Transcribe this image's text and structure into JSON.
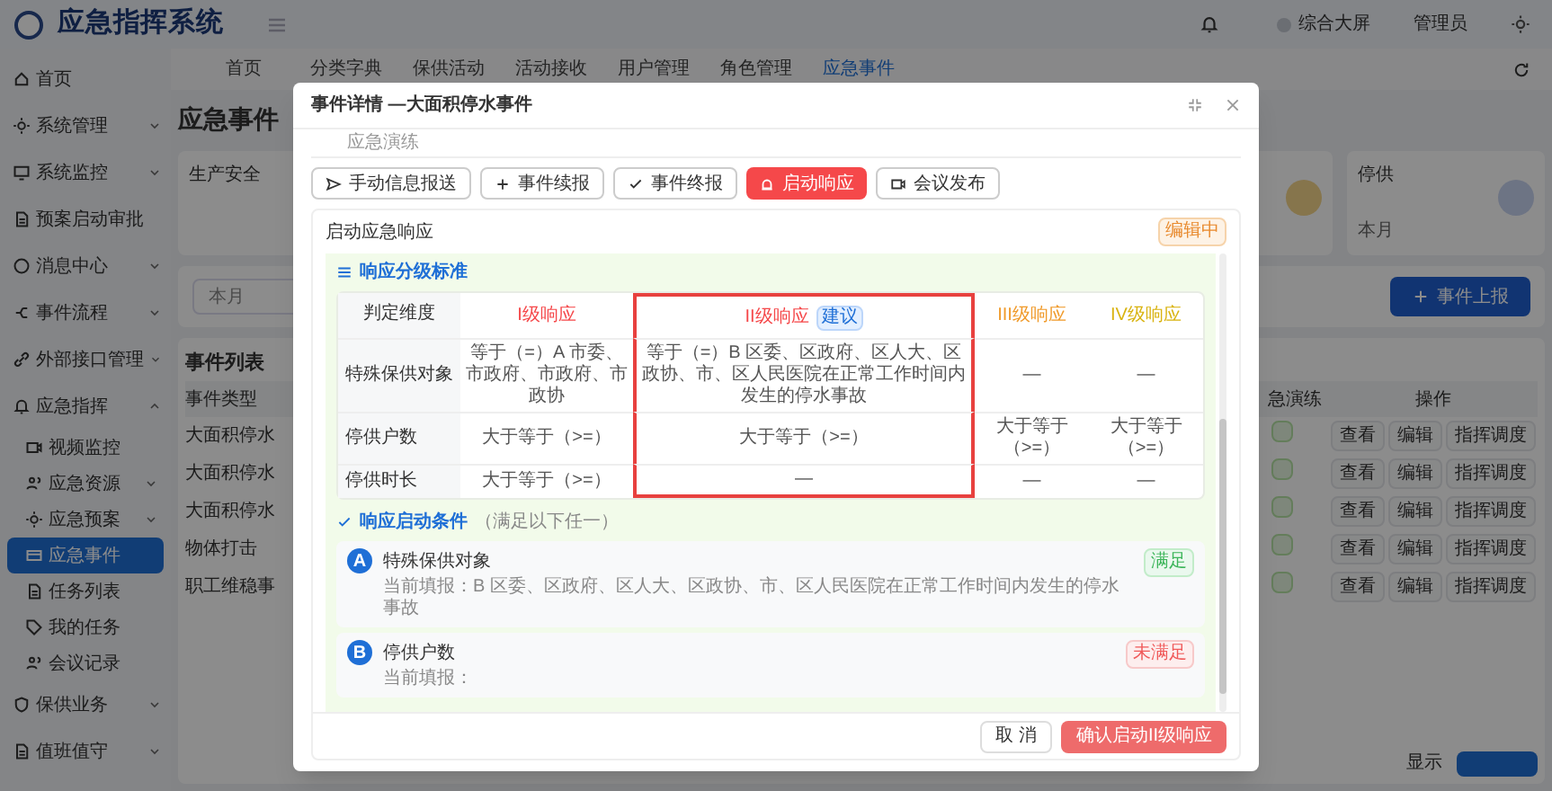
{
  "app": {
    "title": "应急指挥系统",
    "screen_link": "综合大屏",
    "user": "管理员"
  },
  "sidebar": {
    "items": [
      {
        "label": "首页",
        "kind": "link"
      },
      {
        "label": "系统管理",
        "kind": "menu",
        "expanded": false
      },
      {
        "label": "系统监控",
        "kind": "menu",
        "expanded": false
      },
      {
        "label": "预案启动审批",
        "kind": "link"
      },
      {
        "label": "消息中心",
        "kind": "menu",
        "expanded": false
      },
      {
        "label": "事件流程",
        "kind": "menu",
        "expanded": false
      },
      {
        "label": "外部接口管理",
        "kind": "menu",
        "expanded": false
      },
      {
        "label": "应急指挥",
        "kind": "menu",
        "expanded": true,
        "children": [
          {
            "label": "视频监控",
            "kind": "link",
            "selected": false
          },
          {
            "label": "应急资源",
            "kind": "menu",
            "expanded": false,
            "selected": false
          },
          {
            "label": "应急预案",
            "kind": "menu",
            "expanded": false,
            "selected": false
          },
          {
            "label": "应急事件",
            "kind": "link",
            "selected": true
          },
          {
            "label": "任务列表",
            "kind": "link",
            "selected": false
          },
          {
            "label": "我的任务",
            "kind": "link",
            "selected": false
          },
          {
            "label": "会议记录",
            "kind": "link",
            "selected": false
          }
        ]
      },
      {
        "label": "保供业务",
        "kind": "menu",
        "expanded": false
      },
      {
        "label": "值班值守",
        "kind": "menu",
        "expanded": false
      }
    ]
  },
  "tabs": [
    {
      "label": "首页",
      "selected": false
    },
    {
      "label": "分类字典",
      "selected": false
    },
    {
      "label": "保供活动",
      "selected": false
    },
    {
      "label": "活动接收",
      "selected": false
    },
    {
      "label": "用户管理",
      "selected": false
    },
    {
      "label": "角色管理",
      "selected": false
    },
    {
      "label": "应急事件",
      "selected": true
    }
  ],
  "page": {
    "heading": "应急事件",
    "stat_cards": [
      {
        "title": "生产安全"
      },
      {
        "title": "停供",
        "note": "本月"
      }
    ],
    "filter": {
      "value": "本月"
    },
    "report_button": "事件上报",
    "event_list": {
      "title": "事件列表",
      "columns": [
        "事件类型",
        "急演练",
        "操作"
      ],
      "rows": [
        {
          "type": "大面积停水",
          "actions": [
            "查看",
            "编辑",
            "指挥调度"
          ]
        },
        {
          "type": "大面积停水",
          "actions": [
            "查看",
            "编辑",
            "指挥调度"
          ]
        },
        {
          "type": "大面积停水",
          "actions": [
            "查看",
            "编辑",
            "指挥调度"
          ]
        },
        {
          "type": "物体打击",
          "actions": [
            "查看",
            "编辑",
            "指挥调度"
          ]
        },
        {
          "type": "职工维稳事",
          "actions": [
            "查看",
            "编辑",
            "指挥调度"
          ]
        }
      ],
      "pagination": "显示"
    }
  },
  "modal": {
    "title": "事件详情 —大面积停水事件",
    "tab": "应急演练",
    "actions": [
      {
        "label": "手动信息报送",
        "kind": "send",
        "primary": false
      },
      {
        "label": "事件续报",
        "kind": "plus",
        "primary": false
      },
      {
        "label": "事件终报",
        "kind": "check",
        "primary": false
      },
      {
        "label": "启动响应",
        "kind": "alarm",
        "primary": true
      },
      {
        "label": "会议发布",
        "kind": "video",
        "primary": false
      }
    ],
    "section": {
      "title": "启动应急响应",
      "status": "编辑中"
    },
    "grading": {
      "title": "响应分级标准",
      "dimension_header": "判定维度",
      "levels": [
        {
          "name": "I级响应",
          "color": "#f5484a",
          "selected": false
        },
        {
          "name": "II级响应",
          "color": "#f5484a",
          "selected": true,
          "badge": "建议"
        },
        {
          "name": "III级响应",
          "color": "#f09a2a",
          "selected": false
        },
        {
          "name": "IV级响应",
          "color": "#d9b310",
          "selected": false
        }
      ],
      "rows": [
        {
          "dimension": "特殊保供对象",
          "values": [
            "等于（=）A 市委、市政府、市政府、市政协",
            "等于（=）B 区委、区政府、区人大、区政协、市、区人民医院在正常工作时间内发生的停水事故",
            "—",
            "—"
          ]
        },
        {
          "dimension": "停供户数",
          "values": [
            "大于等于（>=）",
            "大于等于（>=）",
            "大于等于（>=）",
            "大于等于（>=）"
          ]
        },
        {
          "dimension": "停供时长",
          "values": [
            "大于等于（>=）",
            "—",
            "—",
            "—"
          ]
        }
      ]
    },
    "conditions": {
      "title": "响应启动条件",
      "note": "（满足以下任一）",
      "items": [
        {
          "letter": "A",
          "title": "特殊保供对象",
          "detail": "当前填报：B 区委、区政府、区人大、区政协、市、区人民医院在正常工作时间内发生的停水事故",
          "met": true,
          "status": "满足"
        },
        {
          "letter": "B",
          "title": "停供户数",
          "detail": "当前填报：",
          "met": false,
          "status": "未满足"
        }
      ]
    },
    "footer": {
      "cancel": "取 消",
      "confirm": "确认启动II级响应"
    }
  }
}
